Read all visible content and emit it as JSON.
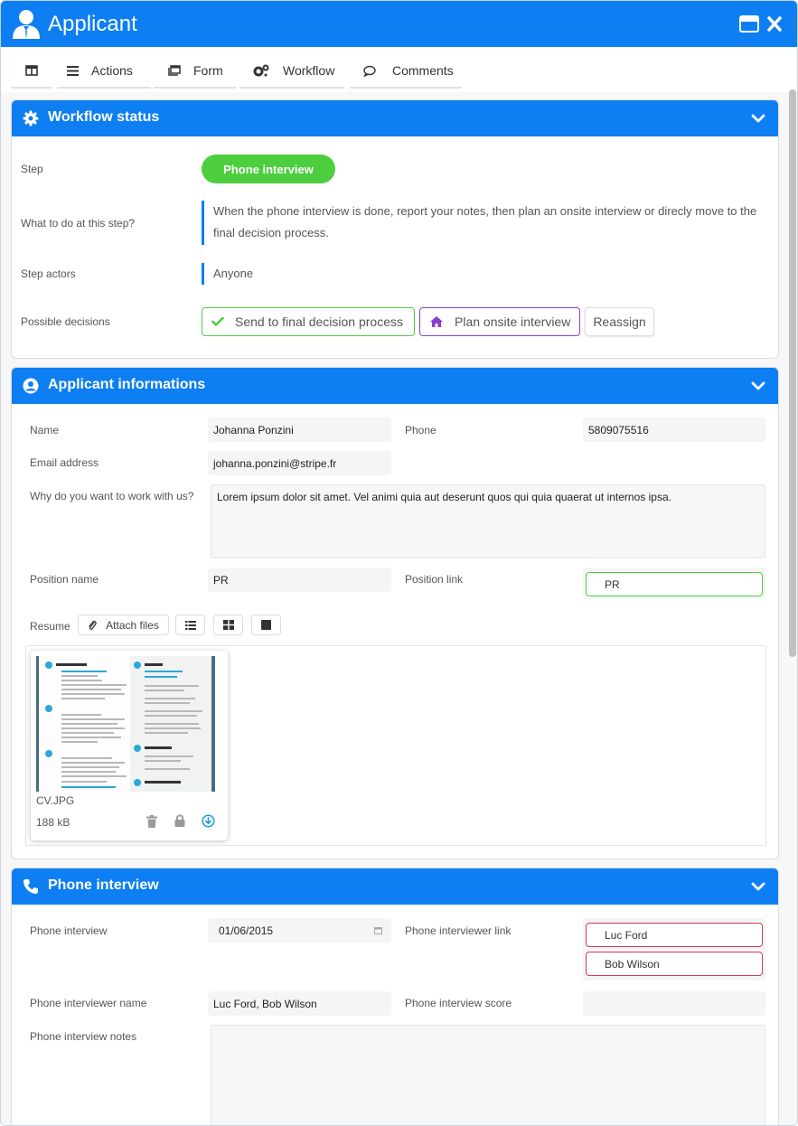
{
  "window": {
    "title": "Applicant"
  },
  "toolbar": {
    "items": [
      {
        "label": ""
      },
      {
        "label": "Actions"
      },
      {
        "label": "Form"
      },
      {
        "label": "Workflow"
      },
      {
        "label": "Comments"
      }
    ]
  },
  "workflow_status": {
    "title": "Workflow status",
    "step_label": "Step",
    "step_value": "Phone interview",
    "todo_label": "What to do at this step?",
    "todo_line1": "When the phone interview is done, report your notes, then plan an onsite interview or direcly move to the",
    "todo_line2": "final decision process.",
    "actors_label": "Step actors",
    "actors_value": "Anyone",
    "decisions_label": "Possible decisions",
    "decisions": [
      {
        "label": "Send to final decision process",
        "color": "#4cce3e"
      },
      {
        "label": "Plan onsite interview",
        "color": "#8a3fd1"
      },
      {
        "label": "Reassign",
        "color": "#dddddd"
      }
    ]
  },
  "applicant": {
    "title": "Applicant informations",
    "name_label": "Name",
    "name_value": "Johanna Ponzini",
    "phone_label": "Phone",
    "phone_value": "5809075516",
    "email_label": "Email address",
    "email_value": "johanna.ponzini@stripe.fr",
    "why_label": "Why do you want to work with us?",
    "why_value": "Lorem ipsum dolor sit amet. Vel animi quia aut deserunt quos qui quia quaerat ut internos ipsa.",
    "position_name_label": "Position name",
    "position_name_value": "PR",
    "position_link_label": "Position link",
    "position_link_value": "PR",
    "resume_label": "Resume",
    "attach_label": "Attach files",
    "file": {
      "name": "CV.JPG",
      "size": "188 kB"
    }
  },
  "phone_interview": {
    "title": "Phone interview",
    "date_label": "Phone interview",
    "date_value": "01/06/2015",
    "interviewer_link_label": "Phone interviewer link",
    "interviewer_links": [
      "Luc Ford",
      "Bob Wilson"
    ],
    "interviewer_name_label": "Phone interviewer name",
    "interviewer_name_value": "Luc Ford, Bob Wilson",
    "score_label": "Phone interview score",
    "score_value": "",
    "notes_label": "Phone interview notes",
    "notes_value": ""
  },
  "colors": {
    "primary": "#0d7ff2",
    "success": "#4cce3e",
    "purple": "#8a3fd1",
    "danger": "#d63a5a"
  }
}
